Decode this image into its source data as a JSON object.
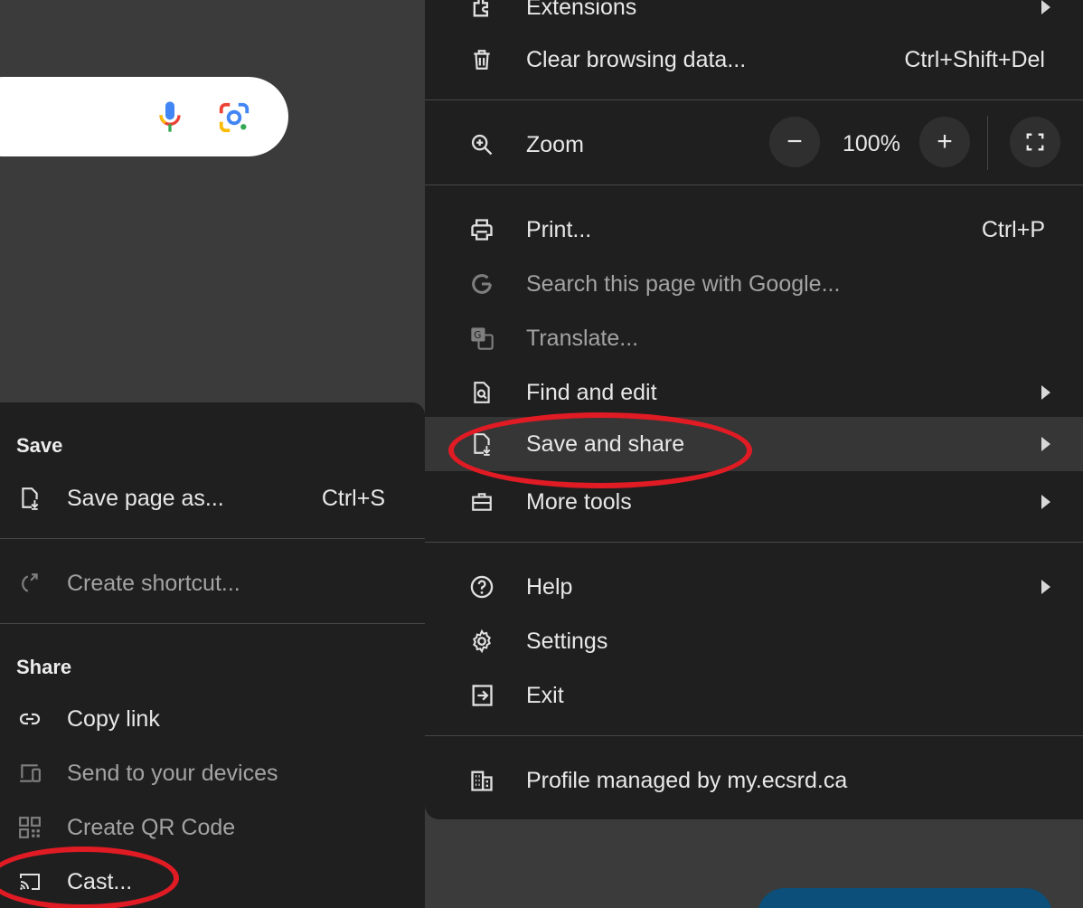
{
  "main_menu": {
    "extensions": "Extensions",
    "clear_browsing": {
      "label": "Clear browsing data...",
      "shortcut": "Ctrl+Shift+Del"
    },
    "zoom": {
      "label": "Zoom",
      "value": "100%",
      "minus": "−",
      "plus": "+"
    },
    "print": {
      "label": "Print...",
      "shortcut": "Ctrl+P"
    },
    "search_page": "Search this page with Google...",
    "translate": "Translate...",
    "find_edit": "Find and edit",
    "save_share": "Save and share",
    "more_tools": "More tools",
    "help": "Help",
    "settings": "Settings",
    "exit": "Exit",
    "profile": "Profile managed by my.ecsrd.ca"
  },
  "sub_menu": {
    "save_title": "Save",
    "save_page": {
      "label": "Save page as...",
      "shortcut": "Ctrl+S"
    },
    "create_shortcut": "Create shortcut...",
    "share_title": "Share",
    "copy_link": "Copy link",
    "send_devices": "Send to your devices",
    "qr_code": "Create QR Code",
    "cast": "Cast..."
  },
  "colors": {
    "menu_bg": "#1f1f1f",
    "highlight": "#363636",
    "annotation": "#e01b24"
  }
}
